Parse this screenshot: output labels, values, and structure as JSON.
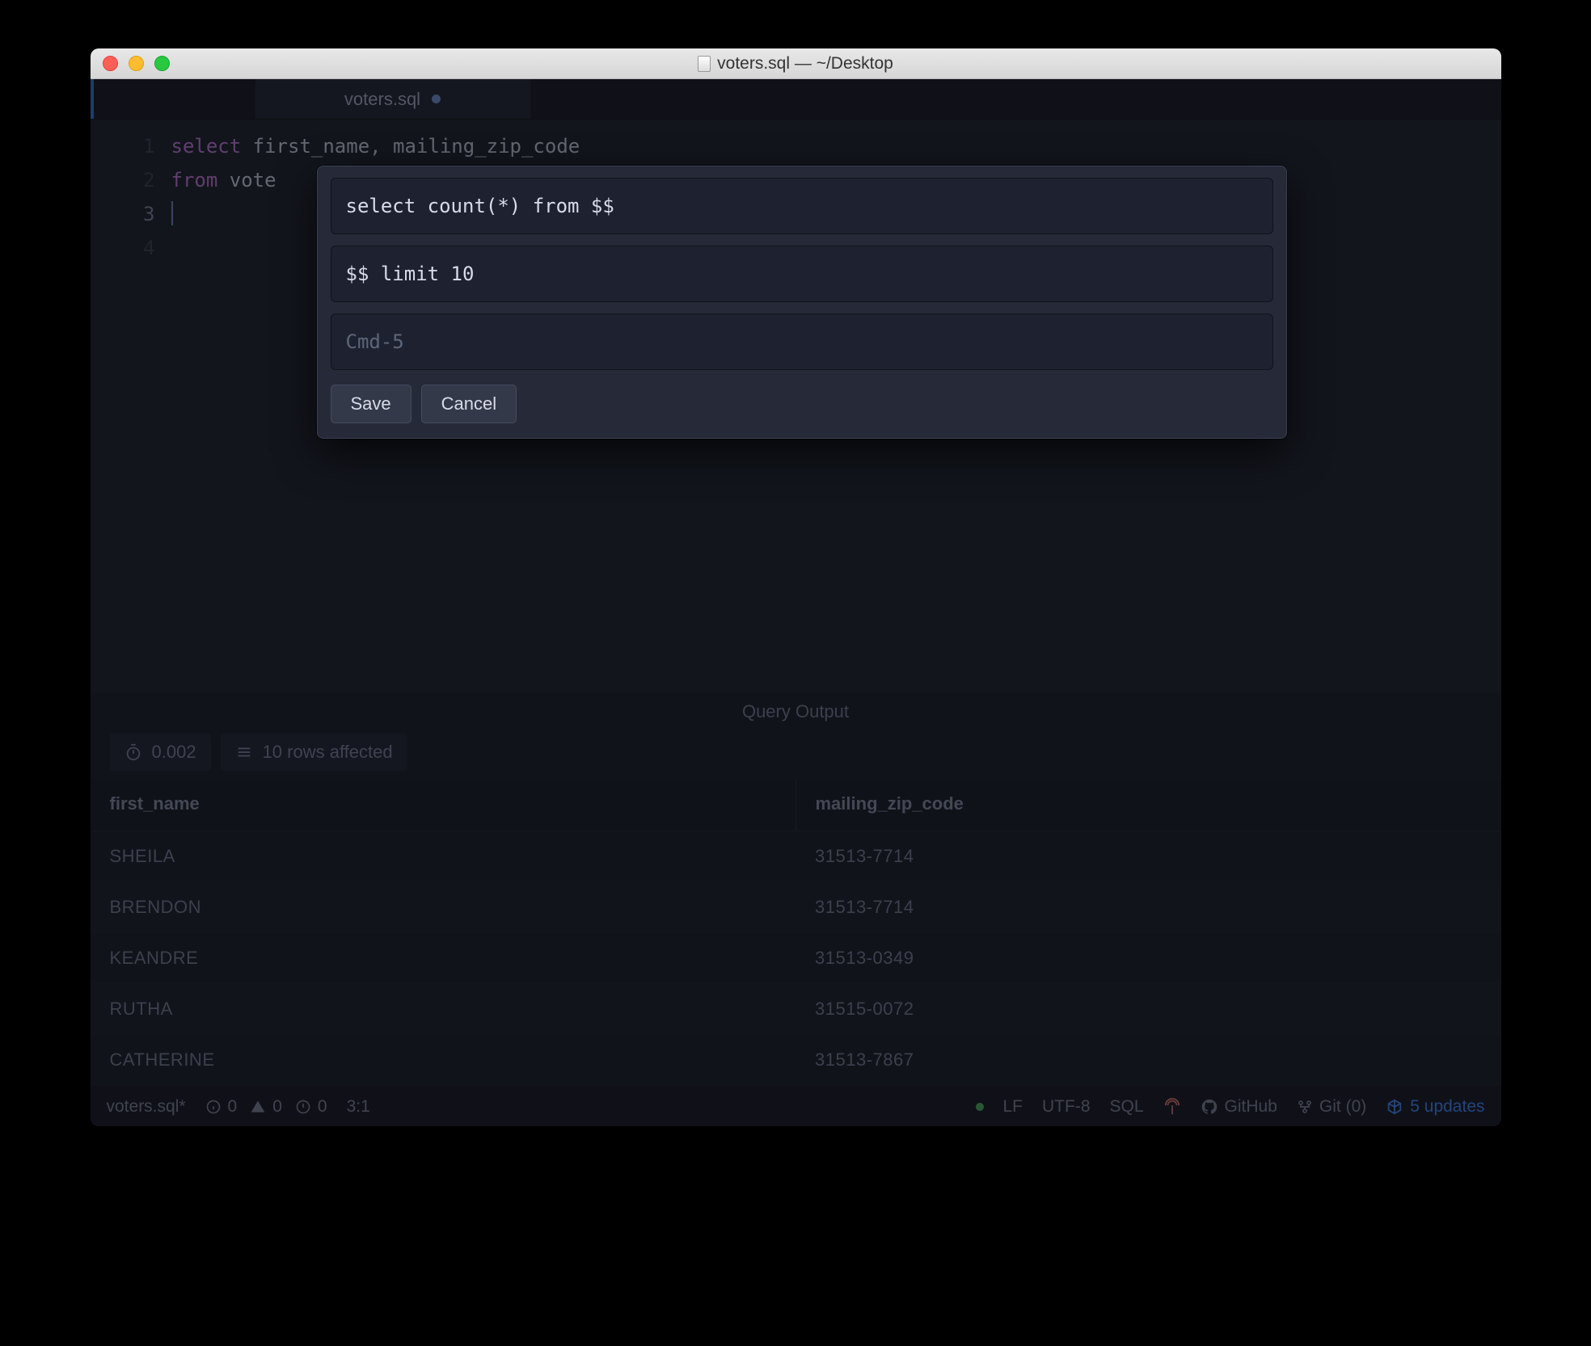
{
  "window": {
    "title": "voters.sql — ~/Desktop"
  },
  "tab": {
    "label": "voters.sql"
  },
  "editor": {
    "gutter": [
      "1",
      "2",
      "3",
      "4"
    ],
    "line1_kw": "select",
    "line1_rest": " first_name, mailing_zip_code",
    "line2_kw": "from",
    "line2_rest": " vote"
  },
  "modal": {
    "input1": "select count(*) from $$",
    "input2": "$$ limit 10",
    "input3_placeholder": "Cmd-5",
    "save": "Save",
    "cancel": "Cancel"
  },
  "queryOutput": {
    "title": "Query Output",
    "elapsed": "0.002",
    "rows_msg": "10 rows affected",
    "columns": [
      "first_name",
      "mailing_zip_code"
    ],
    "rows": [
      {
        "first_name": "SHEILA",
        "mailing_zip_code": "31513-7714"
      },
      {
        "first_name": "BRENDON",
        "mailing_zip_code": "31513-7714"
      },
      {
        "first_name": "KEANDRE",
        "mailing_zip_code": "31513-0349"
      },
      {
        "first_name": "RUTHA",
        "mailing_zip_code": "31515-0072"
      },
      {
        "first_name": "CATHERINE",
        "mailing_zip_code": "31513-7867"
      }
    ]
  },
  "statusbar": {
    "file": "voters.sql*",
    "info_count": "0",
    "warn_count": "0",
    "error_count": "0",
    "cursor_pos": "3:1",
    "eol": "LF",
    "encoding": "UTF-8",
    "language": "SQL",
    "github": "GitHub",
    "git": "Git (0)",
    "updates": "5 updates"
  }
}
